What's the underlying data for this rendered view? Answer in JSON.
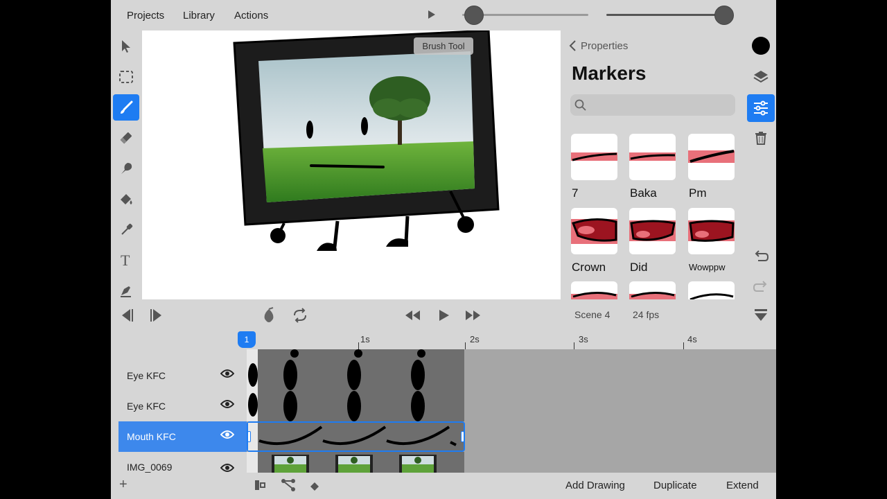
{
  "menu": {
    "projects": "Projects",
    "library": "Library",
    "actions": "Actions"
  },
  "canvas": {
    "tooltip": "Brush Tool"
  },
  "properties": {
    "back_label": "Properties",
    "title": "Markers",
    "search_placeholder": "",
    "markers": [
      {
        "label": "7"
      },
      {
        "label": "Baka"
      },
      {
        "label": "Pm"
      },
      {
        "label": "Crown"
      },
      {
        "label": "Did"
      },
      {
        "label": "Wowppw"
      }
    ]
  },
  "transport": {
    "scene": "Scene 4",
    "fps": "24 fps"
  },
  "timeline": {
    "playhead": "1",
    "ticks": [
      "1s",
      "2s",
      "3s",
      "4s"
    ],
    "layers": [
      {
        "name": "Eye KFC"
      },
      {
        "name": "Eye KFC"
      },
      {
        "name": "Mouth KFC"
      },
      {
        "name": "IMG_0069"
      }
    ]
  },
  "bottom": {
    "add": "+",
    "add_drawing": "Add Drawing",
    "duplicate": "Duplicate",
    "extend": "Extend"
  },
  "colors": {
    "accent": "#1e7cf2",
    "current_color": "#000000",
    "marker_pink": "#e8707a",
    "marker_red": "#b81d2a"
  }
}
